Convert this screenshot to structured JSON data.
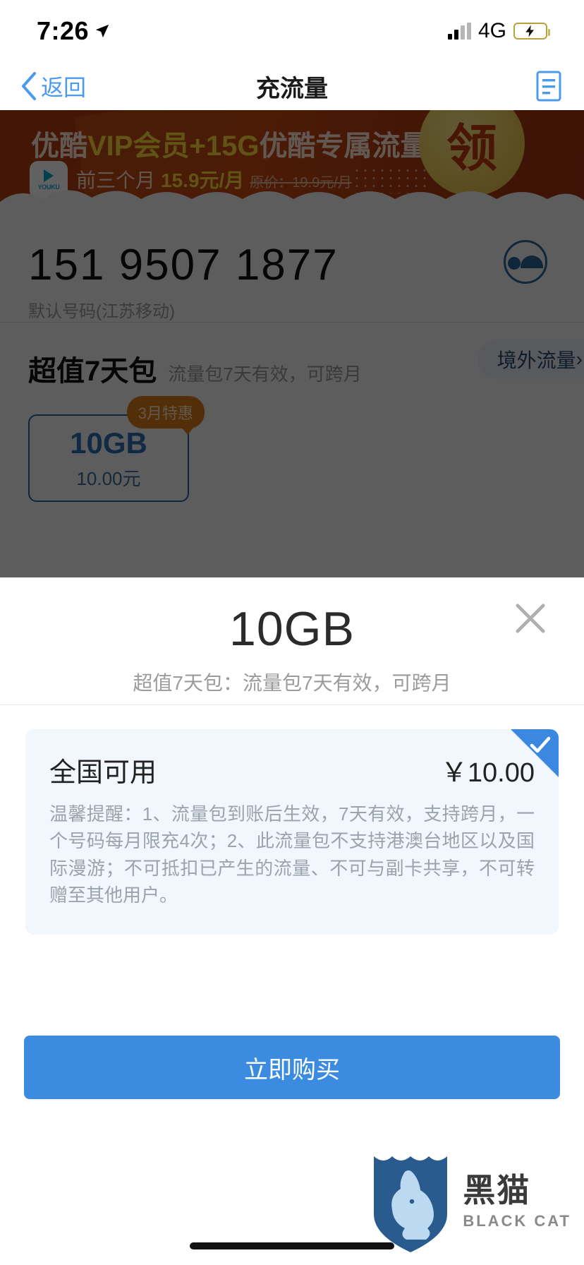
{
  "status_bar": {
    "time": "7:26",
    "location_icon": "location-arrow-icon",
    "signal_icon": "signal-bars-icon",
    "network": "4G",
    "battery_icon": "battery-charging-icon"
  },
  "nav": {
    "back_label": "返回",
    "back_icon": "chevron-left-icon",
    "title": "充流量",
    "right_icon": "document-list-icon"
  },
  "banner": {
    "title_part1": "优酷",
    "title_part2": "VIP会员+15G",
    "title_part3": "优酷专属流量",
    "sub_prefix": "前三个月",
    "sub_price": "15.9元/月",
    "sub_original": "原价：19.9元/月",
    "logo_text": "YOUKU",
    "claim_text": "领"
  },
  "account": {
    "phone_number": "151 9507 1877",
    "subtitle": "默认号码(江苏移动)",
    "avatar_icon": "person-avatar-icon"
  },
  "package_section": {
    "title": "超值7天包",
    "subtitle": "流量包7天有效，可跨月",
    "overseas_label": "境外流量",
    "overseas_chevron": "›",
    "cards": [
      {
        "size": "10GB",
        "price": "10.00元",
        "badge": "3月特惠"
      }
    ]
  },
  "modal": {
    "title": "10GB",
    "subtitle": "超值7天包：流量包7天有效，可跨月",
    "close_icon": "close-x-icon",
    "offer": {
      "name": "全国可用",
      "price": "￥10.00",
      "selected_icon": "check-mark-icon",
      "description": "温馨提醒：1、流量包到账后生效，7天有效，支持跨月，一个号码每月限充4次；2、此流量包不支持港澳台地区以及国际漫游；不可抵扣已产生的流量、不可与副卡共享，不可转赠至其他用户。"
    }
  },
  "buy_button": {
    "label": "立即购买"
  },
  "watermark": {
    "cn": "黑猫",
    "en": "BLACK CAT",
    "logo_icon": "black-cat-shield-icon"
  },
  "colors": {
    "accent": "#3b8ce0",
    "banner": "#b03a12",
    "badge": "#d97b1a",
    "offer_bg": "#f2f6fd"
  }
}
